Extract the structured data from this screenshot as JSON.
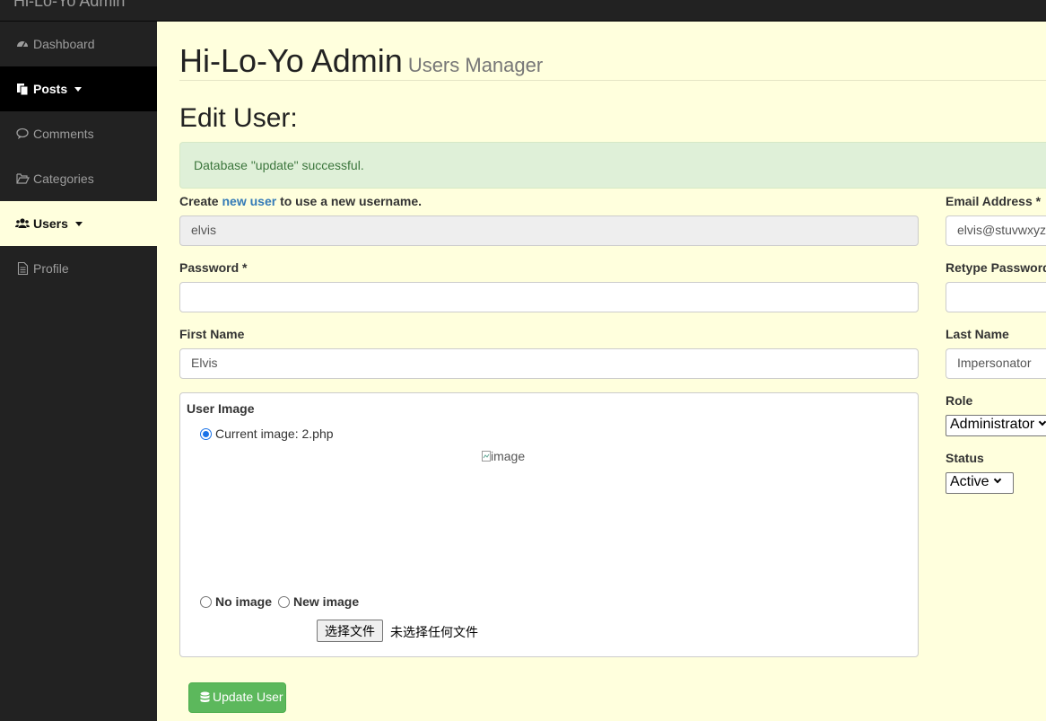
{
  "brand": "Hi-Lo-Yo Admin",
  "sidebar": {
    "items": [
      {
        "label": "Dashboard",
        "icon": "dashboard-icon"
      },
      {
        "label": "Posts",
        "icon": "files-icon"
      },
      {
        "label": "Comments",
        "icon": "comment-icon"
      },
      {
        "label": "Categories",
        "icon": "folder-open-icon"
      },
      {
        "label": "Users",
        "icon": "users-icon"
      },
      {
        "label": "Profile",
        "icon": "file-text-icon"
      }
    ]
  },
  "header": {
    "title": "Hi-Lo-Yo Admin",
    "subtitle": "Users Manager"
  },
  "form": {
    "heading": "Edit User:",
    "alert": "Database \"update\" successful.",
    "username_pre": "Create",
    "username_link": "new user",
    "username_post": "to use a new username.",
    "username_value": "elvis",
    "email_label": "Email Address *",
    "email_value": "elvis@stuvwxyz.com",
    "password_label": "Password *",
    "password_value": "",
    "retype_label": "Retype Password *",
    "retype_value": "",
    "first_name_label": "First Name",
    "first_name_value": "Elvis",
    "last_name_label": "Last Name",
    "last_name_value": "Impersonator",
    "image_label": "User Image",
    "current_image": "Current image: 2.php",
    "image_alt": "image",
    "no_image": "No image",
    "new_image": "New image",
    "file_button": "选择文件",
    "file_status": "未选择任何文件",
    "role_label": "Role",
    "role_value": "Administrator",
    "status_label": "Status",
    "status_value": "Active",
    "submit": "Update User"
  },
  "colors": {
    "sidebar": "#222222",
    "content": "#ffffdd",
    "success": "#5cb85c",
    "alert_bg": "#dff0d8"
  }
}
